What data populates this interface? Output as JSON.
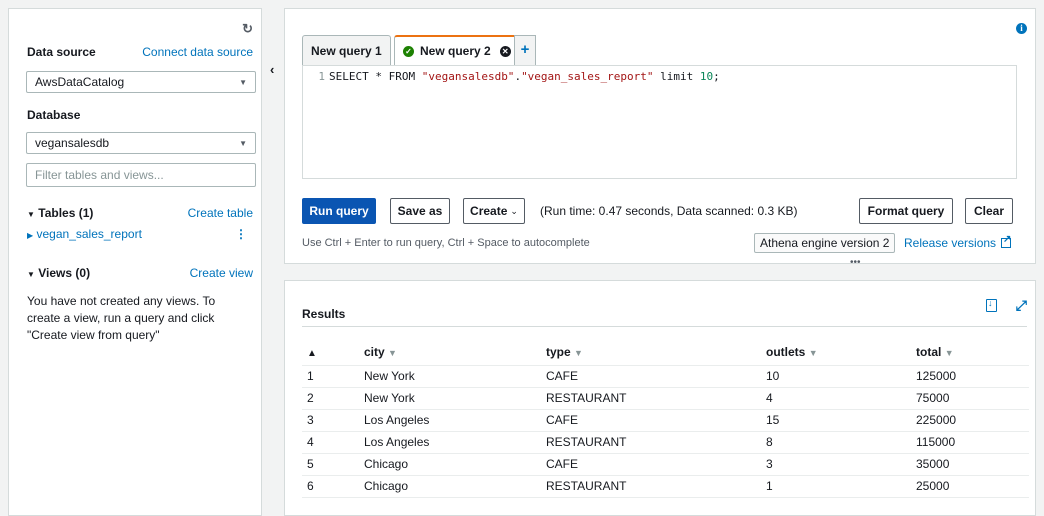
{
  "sidebar": {
    "data_source_label": "Data source",
    "connect_link": "Connect data source",
    "data_source_value": "AwsDataCatalog",
    "database_label": "Database",
    "database_value": "vegansalesdb",
    "filter_placeholder": "Filter tables and views...",
    "tables_label": "Tables (1)",
    "create_table_link": "Create table",
    "tables": [
      {
        "name": "vegan_sales_report"
      }
    ],
    "views_label": "Views (0)",
    "create_view_link": "Create view",
    "views_empty_message": "You have not created any views. To create a view, run a query and click \"Create view from query\""
  },
  "editor": {
    "tabs": [
      {
        "label": "New query 1",
        "active": false
      },
      {
        "label": "New query 2",
        "active": true
      }
    ],
    "add_tab": "+",
    "line_number": "1",
    "query": {
      "keyword_select": "SELECT * FROM ",
      "db_string": "\"vegansalesdb\"",
      "dot": ".",
      "table_string": "\"vegan_sales_report\"",
      "limit_keyword": " limit ",
      "limit_value": "10",
      "end": ";"
    },
    "run_button": "Run query",
    "save_button": "Save as",
    "create_button": "Create",
    "run_info": "(Run time: 0.47 seconds, Data scanned: 0.3 KB)",
    "format_button": "Format query",
    "clear_button": "Clear",
    "hint": "Use Ctrl + Enter to run query, Ctrl + Space to autocomplete",
    "engine_label": "Athena engine version 2",
    "release_link": "Release versions"
  },
  "results": {
    "title": "Results",
    "columns": [
      "city",
      "type",
      "outlets",
      "total"
    ],
    "rows": [
      [
        "1",
        "New York",
        "CAFE",
        "10",
        "125000"
      ],
      [
        "2",
        "New York",
        "RESTAURANT",
        "4",
        "75000"
      ],
      [
        "3",
        "Los Angeles",
        "CAFE",
        "15",
        "225000"
      ],
      [
        "4",
        "Los Angeles",
        "RESTAURANT",
        "8",
        "115000"
      ],
      [
        "5",
        "Chicago",
        "CAFE",
        "3",
        "35000"
      ],
      [
        "6",
        "Chicago",
        "RESTAURANT",
        "1",
        "25000"
      ]
    ]
  },
  "colors": {
    "accent_link": "#0073bb",
    "primary_button": "#0a55b2",
    "active_tab_border": "#ec7211",
    "success": "#1d8102"
  }
}
